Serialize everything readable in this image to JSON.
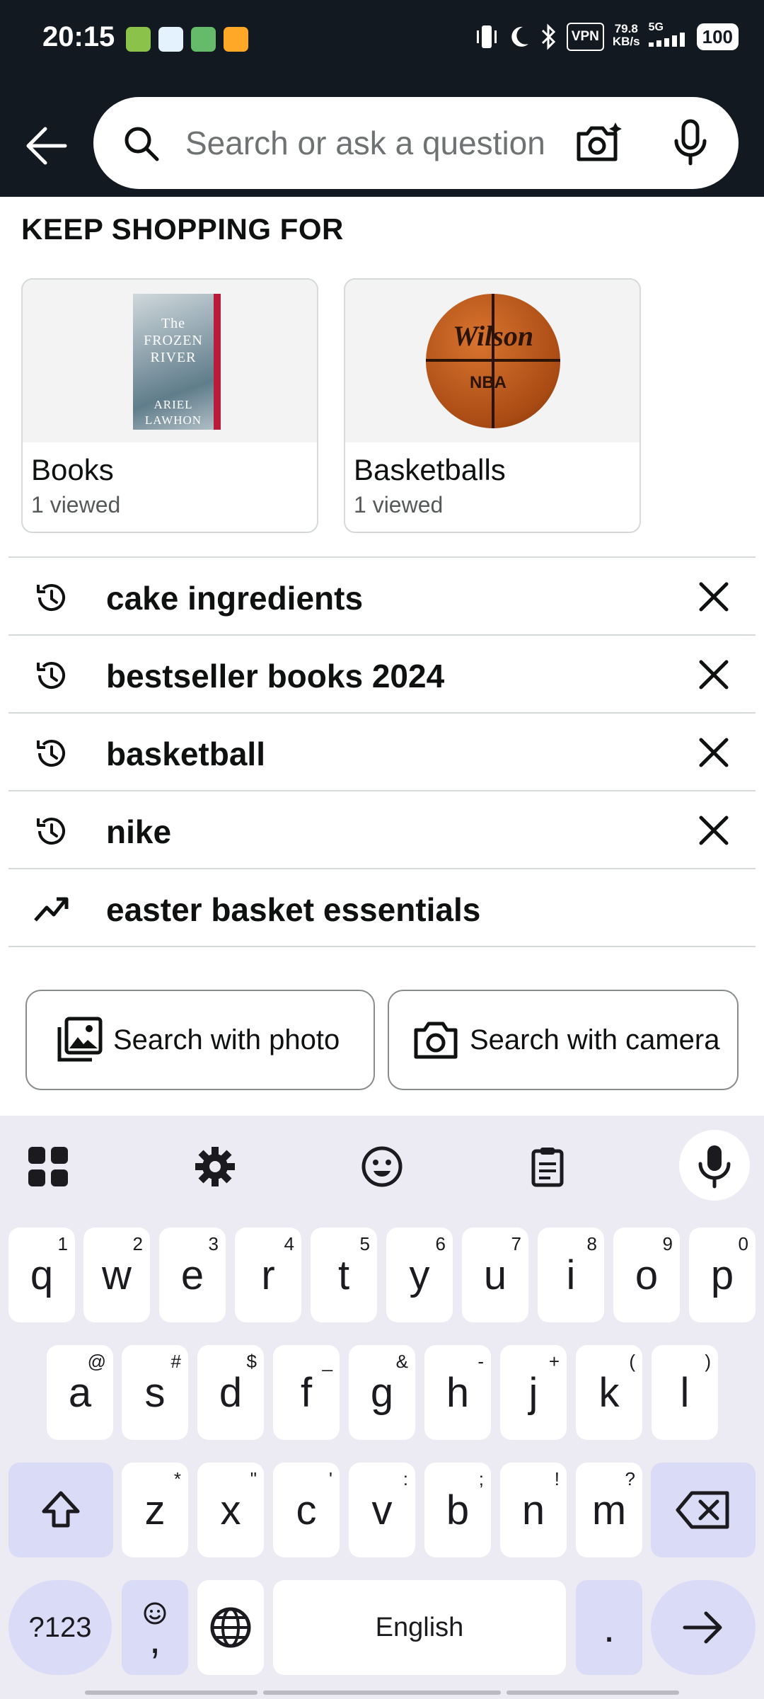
{
  "status_bar": {
    "time": "20:15",
    "vpn": "VPN",
    "speed_value": "79.8",
    "speed_unit": "KB/s",
    "network": "5G",
    "battery": "100"
  },
  "search": {
    "placeholder": "Search or ask a question"
  },
  "keep_shopping": {
    "title": "KEEP SHOPPING FOR",
    "cards": [
      {
        "category": "Books",
        "viewed": "1 viewed",
        "book_title": "The FROZEN RIVER",
        "book_author": "ARIEL LAWHON"
      },
      {
        "category": "Basketballs",
        "viewed": "1 viewed",
        "ball_brand": "Wilson",
        "ball_league": "NBA"
      }
    ]
  },
  "suggestions": [
    {
      "text": "cake ingredients",
      "type": "history-icon"
    },
    {
      "text": "bestseller books 2024",
      "type": "history-icon"
    },
    {
      "text": "basketball",
      "type": "history-icon"
    },
    {
      "text": "nike",
      "type": "history-icon"
    },
    {
      "text": "easter basket essentials",
      "type": "trending-icon"
    }
  ],
  "chips": {
    "photo": "Search with photo",
    "camera": "Search with camera"
  },
  "keyboard": {
    "row1": [
      [
        "q",
        "1"
      ],
      [
        "w",
        "2"
      ],
      [
        "e",
        "3"
      ],
      [
        "r",
        "4"
      ],
      [
        "t",
        "5"
      ],
      [
        "y",
        "6"
      ],
      [
        "u",
        "7"
      ],
      [
        "i",
        "8"
      ],
      [
        "o",
        "9"
      ],
      [
        "p",
        "0"
      ]
    ],
    "row2": [
      [
        "a",
        "@"
      ],
      [
        "s",
        "#"
      ],
      [
        "d",
        "$"
      ],
      [
        "f",
        "_"
      ],
      [
        "g",
        "&"
      ],
      [
        "h",
        "-"
      ],
      [
        "j",
        "+"
      ],
      [
        "k",
        "("
      ],
      [
        "l",
        ")"
      ]
    ],
    "row3": [
      [
        "z",
        "*"
      ],
      [
        "x",
        "\""
      ],
      [
        "c",
        "'"
      ],
      [
        "v",
        ":"
      ],
      [
        "b",
        ";"
      ],
      [
        "n",
        "!"
      ],
      [
        "m",
        "?"
      ]
    ],
    "symbols": "?123",
    "comma": ",",
    "space": "English",
    "period": "."
  },
  "colors": {
    "header_bg": "#131921",
    "keyboard_bg": "#eceaf3",
    "modifier_key": "#dadbf6"
  }
}
